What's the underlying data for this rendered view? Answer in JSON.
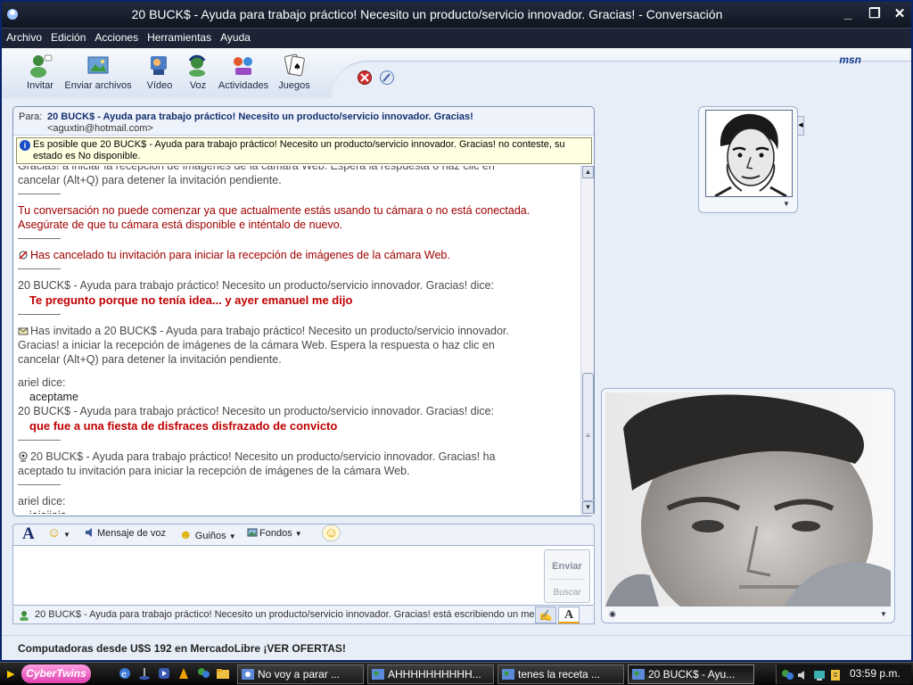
{
  "window": {
    "title": "20 BUCK$ - Ayuda para trabajo práctico! Necesito un producto/servicio innovador. Gracias! - Conversación"
  },
  "menu": [
    "Archivo",
    "Edición",
    "Acciones",
    "Herramientas",
    "Ayuda"
  ],
  "toolbar": {
    "items": [
      {
        "label": "Invitar",
        "icon": "invite-icon"
      },
      {
        "label": "Enviar archivos",
        "icon": "send-files-icon"
      },
      {
        "label": "Vídeo",
        "icon": "video-icon"
      },
      {
        "label": "Voz",
        "icon": "voice-icon"
      },
      {
        "label": "Actividades",
        "icon": "activities-icon"
      },
      {
        "label": "Juegos",
        "icon": "games-icon"
      }
    ],
    "logo": "msn"
  },
  "conversation": {
    "to_label": "Para:",
    "to_name": "20 BUCK$ - Ayuda para trabajo práctico! Necesito un producto/servicio innovador. Gracias!",
    "to_email": "<aguxtin@hotmail.com>",
    "warning": "Es posible que 20 BUCK$ - Ayuda para trabajo práctico! Necesito un producto/servicio innovador. Gracias! no conteste, su estado es No disponible.",
    "history": {
      "line1a": "Gracias! a iniciar la recepción de imágenes de la cámara Web. Espera la respuesta o haz clic en",
      "line1b": "cancelar (Alt+Q) para detener la invitación pendiente.",
      "err_a": "Tu conversación no puede comenzar ya que actualmente estás usando tu cámara o no está conectada.",
      "err_b": "Asegúrate de que tu cámara está disponible e inténtalo de nuevo.",
      "cancel": "Has cancelado tu invitación para iniciar la recepción de imágenes de la cámara Web.",
      "says1": "20 BUCK$ - Ayuda para trabajo práctico! Necesito un producto/servicio innovador. Gracias! dice:",
      "msg1": "Te pregunto porque no tenía idea... y ayer emanuel me dijo",
      "invite_a": "Has invitado a 20 BUCK$ - Ayuda para trabajo práctico! Necesito un producto/servicio innovador.",
      "invite_b": "Gracias! a iniciar la recepción de imágenes de la cámara Web. Espera la respuesta o haz clic en",
      "invite_c": "cancelar (Alt+Q) para detener la invitación pendiente.",
      "ariel1": "ariel dice:",
      "ariel_msg1": "aceptame",
      "says2": "20 BUCK$ - Ayuda para trabajo práctico! Necesito un producto/servicio innovador. Gracias! dice:",
      "msg2": "que fue a una fiesta de disfraces disfrazado de convicto",
      "accepted_a": "20 BUCK$ - Ayuda para trabajo práctico! Necesito un producto/servicio innovador. Gracias! ha",
      "accepted_b": "aceptado tu invitación para iniciar la recepción de imágenes de la cámara Web.",
      "ariel2": "ariel dice:",
      "ariel_msg2": "jajajjaja"
    }
  },
  "format_bar": {
    "voice_clip": "Mensaje de voz",
    "winks": "Guiños",
    "backgrounds": "Fondos"
  },
  "input": {
    "send": "Enviar",
    "search": "Buscar"
  },
  "typing_status": "20 BUCK$ - Ayuda para trabajo práctico! Necesito un producto/servicio innovador. Gracias! está escribiendo un men",
  "ad": "Computadoras desde U$S 192 en MercadoLibre ¡VER OFERTAS!",
  "taskbar": {
    "start_label": "CyberTwins",
    "tasks": [
      {
        "label": "No voy a parar ..."
      },
      {
        "label": "AHHHHHHHHHH..."
      },
      {
        "label": "tenes la receta ..."
      },
      {
        "label": "20 BUCK$ - Ayu..."
      }
    ],
    "clock": "03:59 p.m."
  }
}
